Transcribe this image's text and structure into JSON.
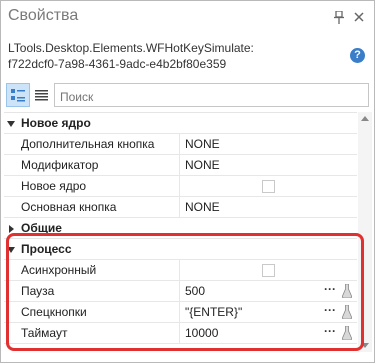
{
  "window": {
    "title": "Свойства",
    "pin_icon": "pin-icon",
    "close_icon": "close-icon"
  },
  "object": {
    "line1": "LTools.Desktop.Elements.WFHotKeySimulate:",
    "line2": "f722dcf0-7a98-4361-9adc-e4b2bf80e359",
    "help_label": "?"
  },
  "toolbar": {
    "search_placeholder": "Поиск"
  },
  "categories": [
    {
      "label": "Новое ядро",
      "expanded": true,
      "rows": [
        {
          "name": "Дополнительная кнопка",
          "value": "NONE"
        },
        {
          "name": "Модификатор",
          "value": "NONE"
        },
        {
          "name": "Новое ядро",
          "value": "",
          "checkbox": false
        },
        {
          "name": "Основная кнопка",
          "value": "NONE"
        }
      ]
    },
    {
      "label": "Общие",
      "expanded": false,
      "rows": []
    },
    {
      "label": "Процесс",
      "expanded": true,
      "rows": [
        {
          "name": "Асинхронный",
          "value": "",
          "checkbox": false
        },
        {
          "name": "Пауза",
          "value": "500",
          "editor": true
        },
        {
          "name": "Спецкнопки",
          "value": "\"{ENTER}\"",
          "editor": true
        },
        {
          "name": "Таймаут",
          "value": "10000",
          "editor": true
        }
      ]
    }
  ],
  "editor_button_label": "···",
  "colors": {
    "highlight": "#e03030",
    "active_toolbar": "#cde3f7",
    "help": "#3a7dc9"
  }
}
